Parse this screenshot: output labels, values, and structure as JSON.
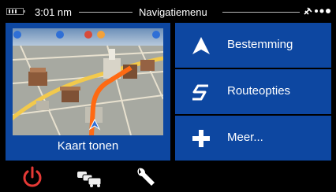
{
  "status": {
    "time": "3:01 nm",
    "title": "Navigatiemenu"
  },
  "map_tile": {
    "label": "Kaart tonen"
  },
  "menu": [
    {
      "label": "Bestemming",
      "icon": "arrow-up-icon"
    },
    {
      "label": "Routeopties",
      "icon": "route-s-icon"
    },
    {
      "label": "Meer...",
      "icon": "plus-icon"
    }
  ],
  "toolbar": {
    "icons": [
      "power-icon",
      "traffic-icon",
      "wrench-icon"
    ]
  },
  "colors": {
    "tile_blue": "#0d47a1",
    "power_red": "#e53935",
    "route_orange": "#ff6a13"
  }
}
